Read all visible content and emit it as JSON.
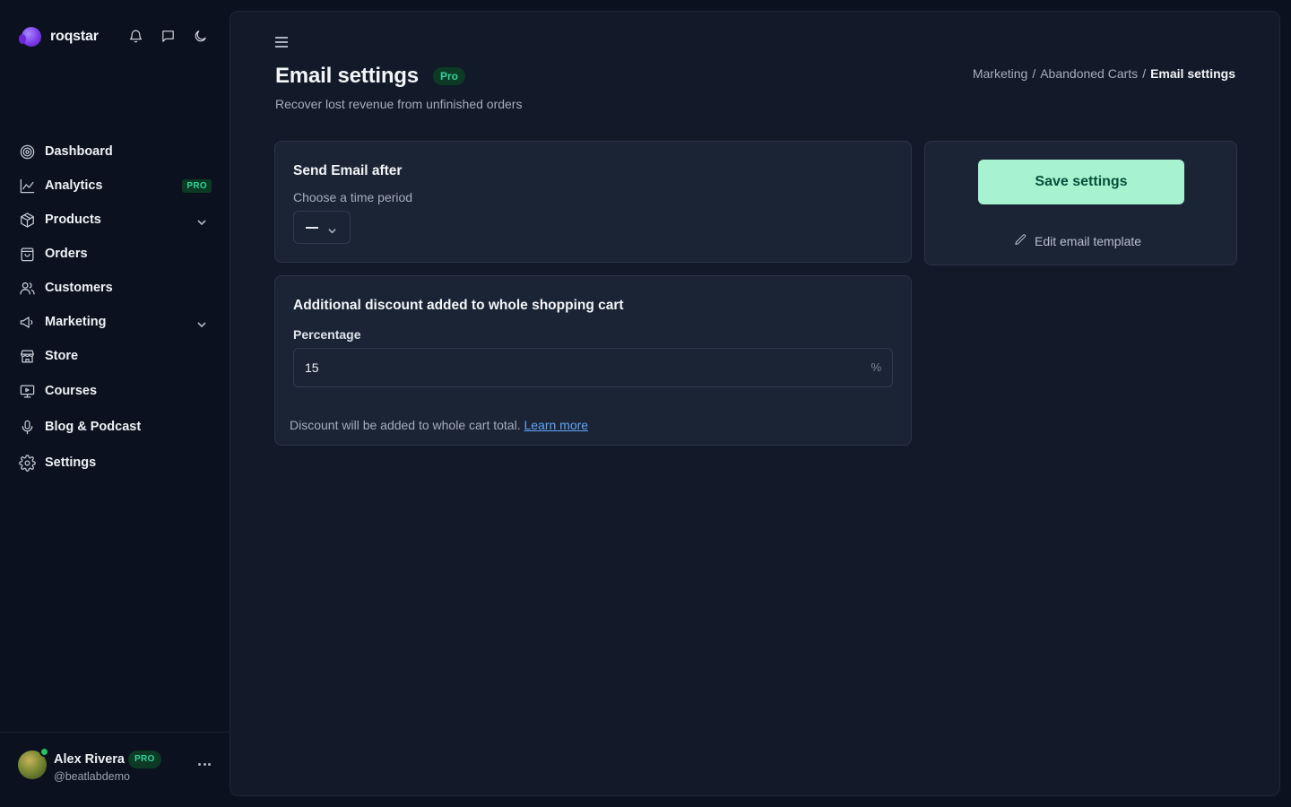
{
  "app": {
    "brand": "roqstar"
  },
  "top_icons": [
    "bell-icon",
    "message-icon",
    "moon-icon"
  ],
  "sidebar": {
    "items": [
      {
        "label": "Dashboard",
        "icon": "target-icon"
      },
      {
        "label": "Analytics",
        "icon": "chart-line-icon",
        "badge": "PRO"
      },
      {
        "label": "Products",
        "icon": "box-icon",
        "expandable": true
      },
      {
        "label": "Orders",
        "icon": "shopping-bag-icon"
      },
      {
        "label": "Customers",
        "icon": "users-icon"
      },
      {
        "label": "Marketing",
        "icon": "megaphone-icon",
        "expandable": true
      },
      {
        "label": "Store",
        "icon": "store-icon"
      },
      {
        "label": "Courses",
        "icon": "presentation-icon"
      },
      {
        "label": "Blog & Podcast",
        "icon": "microphone-icon"
      },
      {
        "label": "Settings",
        "icon": "gear-icon"
      }
    ]
  },
  "user": {
    "name": "Alex Rivera",
    "badge": "PRO",
    "handle": "@beatlabdemo",
    "status": "online"
  },
  "header": {
    "title": "Email settings",
    "title_badge": "Pro",
    "subtitle": "Recover lost revenue from unfinished orders",
    "breadcrumb": [
      "Marketing",
      "/",
      "Abandoned Carts",
      "/",
      "Email settings"
    ]
  },
  "send_email": {
    "title": "Send Email after",
    "hint": "Choose a time period",
    "selected_value": "—"
  },
  "discount": {
    "title": "Additional discount added to whole shopping cart",
    "field_label": "Percentage",
    "value": "15",
    "suffix": "%",
    "footnote": "Discount will be added to whole cart total.",
    "learn_more": "Learn more"
  },
  "actions": {
    "save_label": "Save settings",
    "edit_template_label": "Edit email template"
  },
  "colors": {
    "background": "#0b111e",
    "panel": "#121a29",
    "card": "#1b2435",
    "accent_button": "#a7f3d0",
    "pro_badge_bg": "#0c3a25",
    "pro_badge_text": "#34d399",
    "link": "#60a5fa"
  }
}
